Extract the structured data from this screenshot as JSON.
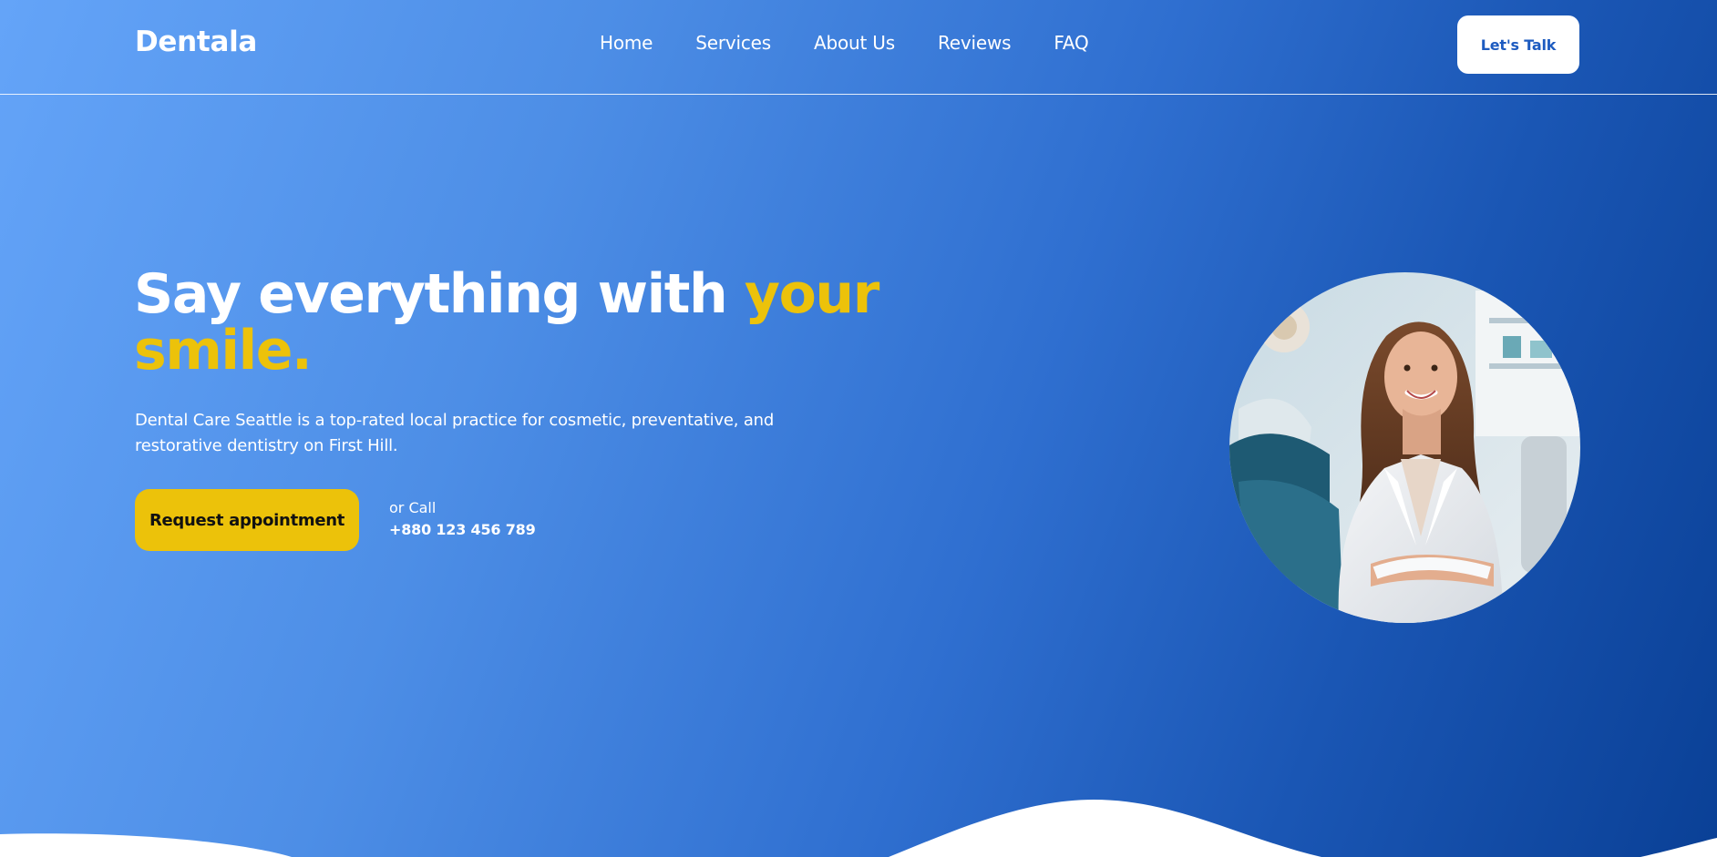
{
  "brand": {
    "name": "Dentala"
  },
  "nav": {
    "items": [
      {
        "label": "Home"
      },
      {
        "label": "Services"
      },
      {
        "label": "About Us"
      },
      {
        "label": "Reviews"
      },
      {
        "label": "FAQ"
      }
    ]
  },
  "header": {
    "cta_label": "Let's Talk"
  },
  "hero": {
    "title_main": "Say everything with ",
    "title_accent": "your smile.",
    "description": "Dental Care Seattle is a top-rated local practice for cosmetic, preventative, and restorative dentistry on First Hill.",
    "primary_button": "Request appointment",
    "call_label": "or Call",
    "call_phone": "+880 123 456 789",
    "image_icon": "dentist-portrait"
  },
  "colors": {
    "accent": "#ecc20a",
    "gradient_start": "#64a4f8",
    "gradient_end": "#0a4096",
    "cta_text": "#1d5bc0"
  }
}
